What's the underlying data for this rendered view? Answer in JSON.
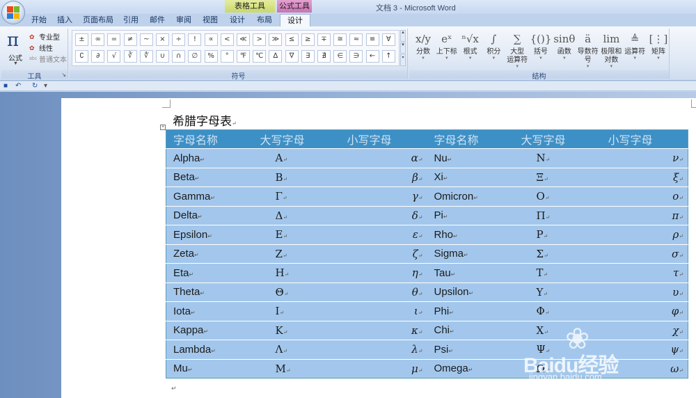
{
  "window": {
    "title": "文档 3 - Microsoft Word"
  },
  "context_tabs": {
    "table_tools": "表格工具",
    "formula_tools": "公式工具"
  },
  "ribbon_tabs": [
    {
      "label": "开始"
    },
    {
      "label": "插入"
    },
    {
      "label": "页面布局"
    },
    {
      "label": "引用"
    },
    {
      "label": "邮件"
    },
    {
      "label": "审阅"
    },
    {
      "label": "视图"
    },
    {
      "label": "设计"
    },
    {
      "label": "布局"
    },
    {
      "label": "设计",
      "active": true
    }
  ],
  "tools_group": {
    "formula_label": "公式",
    "professional": "专业型",
    "linear": "线性",
    "normal_text": "普通文本",
    "group_label": "工具"
  },
  "symbols_group": {
    "group_label": "符号",
    "symbols": [
      "±",
      "∞",
      "=",
      "≠",
      "~",
      "×",
      "÷",
      "!",
      "∝",
      "<",
      "≪",
      ">",
      "≫",
      "≤",
      "≥",
      "∓",
      "≅",
      "≈",
      "≡",
      "∀",
      "∁",
      "∂",
      "√",
      "∛",
      "∜",
      "∪",
      "∩",
      "∅",
      "%",
      "°",
      "℉",
      "℃",
      "∆",
      "∇",
      "∃",
      "∄",
      "∈",
      "∋",
      "←",
      "↑"
    ]
  },
  "structures_group": {
    "group_label": "结构",
    "items": [
      {
        "icon": "x/y",
        "label": "分数",
        "label2": ""
      },
      {
        "icon": "eˣ",
        "label": "上下标",
        "label2": ""
      },
      {
        "icon": "ⁿ√x",
        "label": "根式",
        "label2": ""
      },
      {
        "icon": "∫",
        "label": "积分",
        "label2": ""
      },
      {
        "icon": "∑",
        "label": "大型",
        "label2": "运算符"
      },
      {
        "icon": "{()}",
        "label": "括号",
        "label2": ""
      },
      {
        "icon": "sinθ",
        "label": "函数",
        "label2": ""
      },
      {
        "icon": "ä",
        "label": "导数符号",
        "label2": ""
      },
      {
        "icon": "lim",
        "label": "极限和",
        "label2": "对数"
      },
      {
        "icon": "≜",
        "label": "运算符",
        "label2": ""
      },
      {
        "icon": "[⋮]",
        "label": "矩阵",
        "label2": ""
      }
    ]
  },
  "document": {
    "title": "希腊字母表",
    "table": {
      "headers": [
        "字母名称",
        "大写字母",
        "小写字母",
        "字母名称",
        "大写字母",
        "小写字母"
      ],
      "rows": [
        [
          "Alpha",
          "Α",
          "α",
          "Nu",
          "Ν",
          "ν"
        ],
        [
          "Beta",
          "Β",
          "β",
          "Xi",
          "Ξ",
          "ξ"
        ],
        [
          "Gamma",
          "Γ",
          "γ",
          "Omicron",
          "Ο",
          "ο"
        ],
        [
          "Delta",
          "Δ",
          "δ",
          "Pi",
          "Π",
          "π"
        ],
        [
          "Epsilon",
          "Ε",
          "ε",
          "Rho",
          "Ρ",
          "ρ"
        ],
        [
          "Zeta",
          "Ζ",
          "ζ",
          "Sigma",
          "Σ",
          "σ"
        ],
        [
          "Eta",
          "Η",
          "η",
          "Tau",
          "Τ",
          "τ"
        ],
        [
          "Theta",
          "Θ",
          "θ",
          "Upsilon",
          "Υ",
          "υ"
        ],
        [
          "Iota",
          "Ι",
          "ι",
          "Phi",
          "Φ",
          "φ"
        ],
        [
          "Kappa",
          "Κ",
          "κ",
          "Chi",
          "Χ",
          "χ"
        ],
        [
          "Lambda",
          "Λ",
          "λ",
          "Psi",
          "Ψ",
          "ψ"
        ],
        [
          "Mu",
          "Μ",
          "μ",
          "Omega",
          "Ω",
          "ω"
        ]
      ]
    }
  },
  "watermark": {
    "brand": "Baidu经验",
    "url": "jingyan.baidu.com"
  },
  "colors": {
    "table_header": "#3d90c6",
    "table_body": "#a3c7ec",
    "ribbon_bg": "#dde7f4"
  }
}
